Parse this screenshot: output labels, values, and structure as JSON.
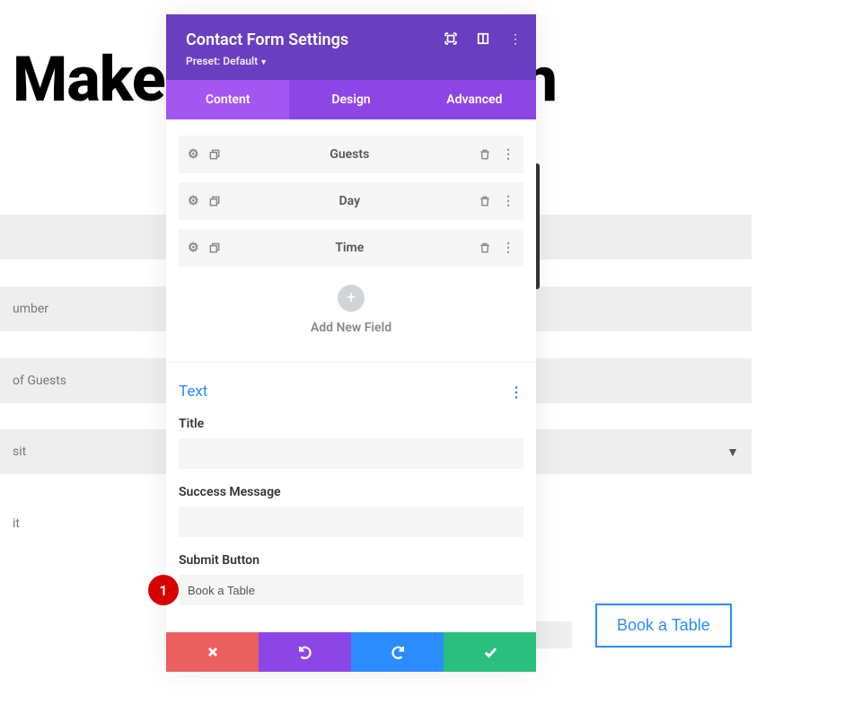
{
  "bg": {
    "heading": "Make a Reservation",
    "fields": [
      "",
      "umber",
      "of Guests",
      "sit",
      "it"
    ],
    "book_btn": "Book a Table"
  },
  "modal": {
    "title": "Contact Form Settings",
    "preset": "Preset: Default",
    "tabs": {
      "content": "Content",
      "design": "Design",
      "advanced": "Advanced"
    },
    "fields": [
      {
        "label": "Guests"
      },
      {
        "label": "Day"
      },
      {
        "label": "Time"
      }
    ],
    "add_new": "Add New Field",
    "text_section": {
      "heading": "Text",
      "title_label": "Title",
      "title_value": "",
      "success_label": "Success Message",
      "success_value": "",
      "submit_label": "Submit Button",
      "submit_value": "Book a Table"
    }
  },
  "annotation": {
    "badge": "1"
  }
}
